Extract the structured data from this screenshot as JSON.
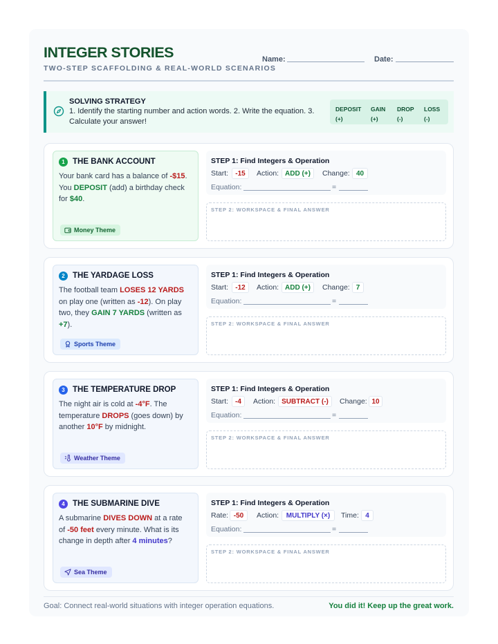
{
  "header": {
    "title": "INTEGER STORIES",
    "subtitle": "TWO-STEP SCAFFOLDING & REAL-WORLD SCENARIOS",
    "name_label": "Name:",
    "date_label": "Date:"
  },
  "strategy": {
    "title": "SOLVING STRATEGY",
    "body": "1. Identify the starting number and action words. 2. Write the equation. 3. Calculate your answer!",
    "keys": [
      {
        "word": "DEPOSIT",
        "sign": "(+)"
      },
      {
        "word": "GAIN",
        "sign": "(+)"
      },
      {
        "word": "DROP",
        "sign": "(-)"
      },
      {
        "word": "LOSS",
        "sign": "(-)"
      }
    ]
  },
  "problems": [
    {
      "number": "1",
      "title": "THE BANK ACCOUNT",
      "theme": "Money Theme",
      "story": {
        "t1": "Your bank card has a balance of ",
        "h1": "-$15",
        "t2": ". You ",
        "h2": "DEPOSIT",
        "t3": " (add) a birthday check for ",
        "h3": "$40",
        "t4": "."
      },
      "step1_title": "STEP 1: Find Integers & Operation",
      "first_label": "Start:",
      "first_value": "-15",
      "action_label": "Action:",
      "action_value": "ADD (+)",
      "change_label": "Change:",
      "change_value": "40",
      "equation_label": "Equation:",
      "equals": "=",
      "workspace_label": "STEP 2: WORKSPACE & FINAL ANSWER"
    },
    {
      "number": "2",
      "title": "THE YARDAGE LOSS",
      "theme": "Sports Theme",
      "story": {
        "t1": "The football team ",
        "h1": "LOSES 12 YARDS",
        "t2": " on play one (written as ",
        "h2": "-12",
        "t3": "). On play two, they ",
        "h3": "GAIN 7 YARDS",
        "t4": " (written as ",
        "h4": "+7",
        "t5": ")."
      },
      "step1_title": "STEP 1: Find Integers & Operation",
      "first_label": "Start:",
      "first_value": "-12",
      "action_label": "Action:",
      "action_value": "ADD (+)",
      "change_label": "Change:",
      "change_value": "7",
      "equation_label": "Equation:",
      "equals": "=",
      "workspace_label": "STEP 2: WORKSPACE & FINAL ANSWER"
    },
    {
      "number": "3",
      "title": "THE TEMPERATURE DROP",
      "theme": "Weather Theme",
      "story": {
        "t1": "The night air is cold at ",
        "h1": "-4°F",
        "t2": ". The temperature ",
        "h2": "DROPS",
        "t3": " (goes down) by another ",
        "h3": "10°F",
        "t4": " by midnight."
      },
      "step1_title": "STEP 1: Find Integers & Operation",
      "first_label": "Start:",
      "first_value": "-4",
      "action_label": "Action:",
      "action_value": "SUBTRACT (-)",
      "change_label": "Change:",
      "change_value": "10",
      "equation_label": "Equation:",
      "equals": "=",
      "workspace_label": "STEP 2: WORKSPACE & FINAL ANSWER"
    },
    {
      "number": "4",
      "title": "THE SUBMARINE DIVE",
      "theme": "Sea Theme",
      "story": {
        "t1": "A submarine ",
        "h1": "DIVES DOWN",
        "t2": " at a rate of ",
        "h2": "-50 feet",
        "t3": " every minute. What is its change in depth after ",
        "h3": "4 minutes",
        "t4": "?"
      },
      "step1_title": "STEP 1: Find Integers & Operation",
      "first_label": "Rate:",
      "first_value": "-50",
      "action_label": "Action:",
      "action_value": "MULTIPLY (×)",
      "change_label": "Time:",
      "change_value": "4",
      "equation_label": "Equation:",
      "equals": "=",
      "workspace_label": "STEP 2: WORKSPACE & FINAL ANSWER"
    }
  ],
  "footer": {
    "goal": "Goal: Connect real-world situations with integer operation equations.",
    "cheer": "You did it! Keep up the great work."
  },
  "colors": {
    "title_green": "#14532d",
    "accent_teal": "#0d9488",
    "red": "#b91c1c",
    "green": "#15803d",
    "indigo": "#4338ca"
  }
}
